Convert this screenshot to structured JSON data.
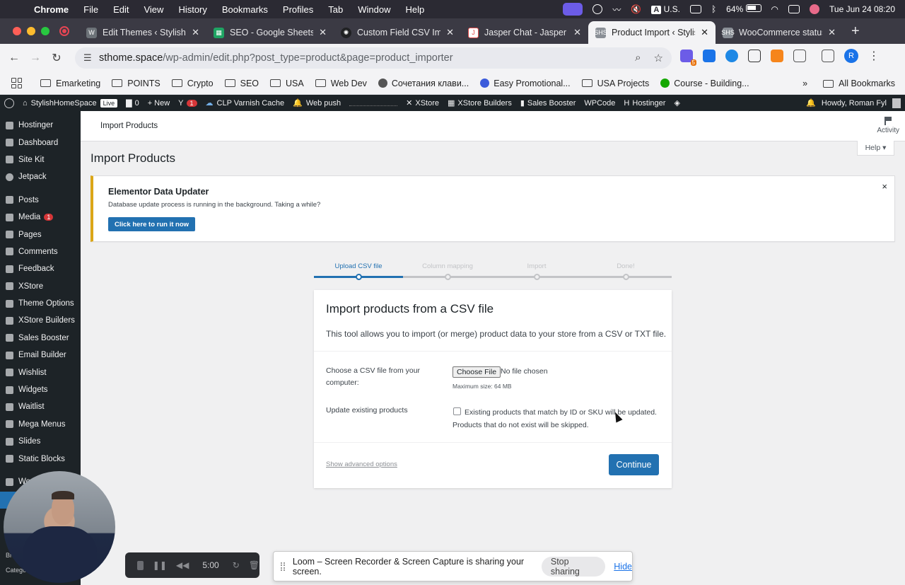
{
  "mac_menu": {
    "app": "Chrome",
    "items": [
      "File",
      "Edit",
      "View",
      "History",
      "Bookmarks",
      "Profiles",
      "Tab",
      "Window",
      "Help"
    ],
    "input_source": "U.S.",
    "battery": "64%",
    "datetime": "Tue Jun 24  08:20"
  },
  "tabs": [
    {
      "title": "Edit Themes ‹ StylishH",
      "icon": "wordpress-icon",
      "color": "#6c7278"
    },
    {
      "title": "SEO - Google Sheets",
      "icon": "google-sheets-icon",
      "color": "#1fa463"
    },
    {
      "title": "Custom Field CSV Imp",
      "icon": "openai-icon",
      "color": "#202123"
    },
    {
      "title": "Jasper Chat - Jasper",
      "icon": "jasper-icon",
      "color": "#e24c4b"
    },
    {
      "title": "Product Import ‹ Stylis",
      "icon": "stylish-icon",
      "color": "#8a8f96",
      "active": true
    },
    {
      "title": "WooCommerce status",
      "icon": "stylish-icon",
      "color": "#8a8f96"
    }
  ],
  "address": {
    "url_host": "sthome.space",
    "url_path": "/wp-admin/edit.php?post_type=product&page=product_importer",
    "extension_badge": "5",
    "profile_initial": "R"
  },
  "bookmarks": {
    "items": [
      {
        "label": "Emarketing",
        "kind": "folder"
      },
      {
        "label": "POINTS",
        "kind": "folder"
      },
      {
        "label": "Crypto",
        "kind": "folder"
      },
      {
        "label": "SEO",
        "kind": "folder"
      },
      {
        "label": "USA",
        "kind": "folder"
      },
      {
        "label": "Web Dev",
        "kind": "folder"
      },
      {
        "label": "Сочетания клави...",
        "kind": "apple"
      },
      {
        "label": "Easy Promotional...",
        "kind": "site"
      },
      {
        "label": "USA Projects",
        "kind": "folder"
      },
      {
        "label": "Course - Building...",
        "kind": "upwork"
      }
    ],
    "more": "»",
    "all": "All Bookmarks"
  },
  "wp_admin_bar": {
    "site": "StylishHomeSpace",
    "live": "Live",
    "comments": "0",
    "new": "New",
    "yoast_badge": "1",
    "varnish": "CLP Varnish Cache",
    "webpush": "Web push",
    "xstore": "XStore",
    "builders": "XStore Builders",
    "sales": "Sales Booster",
    "wpcode": "WPCode",
    "hostinger": "Hostinger",
    "howdy": "Howdy, Roman Fyl"
  },
  "sidebar": {
    "items": [
      {
        "label": "Hostinger"
      },
      {
        "label": "Dashboard"
      },
      {
        "label": "Site Kit"
      },
      {
        "label": "Jetpack"
      },
      {
        "label": "Posts"
      },
      {
        "label": "Media",
        "badge": "1"
      },
      {
        "label": "Pages"
      },
      {
        "label": "Comments"
      },
      {
        "label": "Feedback"
      },
      {
        "label": "XStore"
      },
      {
        "label": "Theme Options"
      },
      {
        "label": "XStore Builders"
      },
      {
        "label": "Sales Booster"
      },
      {
        "label": "Email Builder"
      },
      {
        "label": "Wishlist"
      },
      {
        "label": "Widgets"
      },
      {
        "label": "Waitlist"
      },
      {
        "label": "Mega Menus"
      },
      {
        "label": "Slides"
      },
      {
        "label": "Static Blocks"
      }
    ],
    "cut_off": [
      "Wo",
      "Bra",
      "Catego"
    ]
  },
  "page": {
    "breadcrumb": "Import Products",
    "activity": "Activity",
    "help": "Help ▾",
    "title": "Import Products"
  },
  "notice": {
    "title": "Elementor Data Updater",
    "text": "Database update process is running in the background. Taking a while?",
    "button": "Click here to run it now",
    "close": "×"
  },
  "steps": [
    {
      "label": "Upload CSV file",
      "active": true
    },
    {
      "label": "Column mapping",
      "active": false
    },
    {
      "label": "Import",
      "active": false
    },
    {
      "label": "Done!",
      "active": false
    }
  ],
  "importer": {
    "heading": "Import products from a CSV file",
    "description": "This tool allows you to import (or merge) product data to your store from a CSV or TXT file.",
    "file_label": "Choose a CSV file from your computer:",
    "choose_file": "Choose File",
    "no_file": "No file chosen",
    "max_size": "Maximum size: 64 MB",
    "update_label": "Update existing products",
    "update_text": "Existing products that match by ID or SKU will be updated. Products that do not exist will be skipped.",
    "advanced": "Show advanced options",
    "continue": "Continue"
  },
  "recorder": {
    "time": "5:00"
  },
  "loom": {
    "message": "Loom – Screen Recorder & Screen Capture is sharing your screen.",
    "stop": "Stop sharing",
    "hide": "Hide"
  }
}
